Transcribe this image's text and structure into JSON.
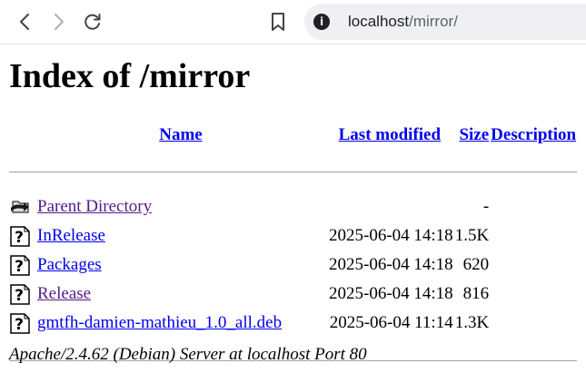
{
  "browser": {
    "url_host": "localhost",
    "url_path": "/mirror/",
    "icons": [
      "back-icon",
      "forward-icon",
      "reload-icon",
      "bookmark-icon",
      "info-icon"
    ]
  },
  "page": {
    "title": "Index of /mirror",
    "columns": {
      "name": "Name",
      "modified": "Last modified",
      "size": "Size",
      "description": "Description"
    },
    "rows": [
      {
        "name": "Parent Directory",
        "modified": "",
        "size": "-",
        "description": "",
        "icon": "back-folder-icon",
        "visited": true
      },
      {
        "name": "InRelease",
        "modified": "2025-06-04 14:18",
        "size": "1.5K",
        "description": "",
        "icon": "unknown-file-icon",
        "visited": false
      },
      {
        "name": "Packages",
        "modified": "2025-06-04 14:18",
        "size": "620",
        "description": "",
        "icon": "unknown-file-icon",
        "visited": false
      },
      {
        "name": "Release",
        "modified": "2025-06-04 14:18",
        "size": "816",
        "description": "",
        "icon": "unknown-file-icon",
        "visited": true
      },
      {
        "name": "gmtfh-damien-mathieu_1.0_all.deb",
        "modified": "2025-06-04 11:14",
        "size": "1.3K",
        "description": "",
        "icon": "unknown-file-icon",
        "visited": false
      }
    ],
    "footer": "Apache/2.4.62 (Debian) Server at localhost Port 80"
  }
}
